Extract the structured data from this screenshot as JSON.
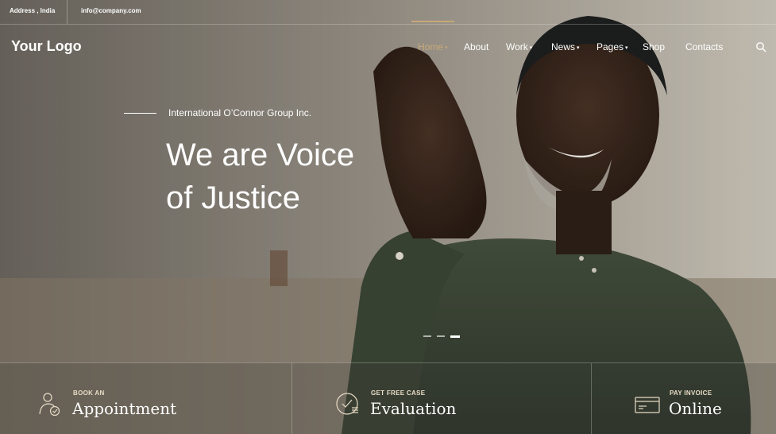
{
  "topbar": {
    "address": "Address , India",
    "email": "info@company.com"
  },
  "header": {
    "logo": "Your Logo"
  },
  "nav": {
    "items": [
      {
        "label": "Home",
        "active": true,
        "has_dropdown": true
      },
      {
        "label": "About",
        "active": false,
        "has_dropdown": false
      },
      {
        "label": "Work",
        "active": false,
        "has_dropdown": true
      },
      {
        "label": "News",
        "active": false,
        "has_dropdown": true
      },
      {
        "label": "Pages",
        "active": false,
        "has_dropdown": true
      },
      {
        "label": "Shop",
        "active": false,
        "has_dropdown": false
      },
      {
        "label": "Contacts",
        "active": false,
        "has_dropdown": false
      }
    ],
    "search_icon": "search-icon"
  },
  "hero": {
    "eyebrow": "International O’Connor Group Inc.",
    "headline_line1": "We are Voice",
    "headline_line2": "of Justice"
  },
  "slider": {
    "slides": 3,
    "active_index": 2
  },
  "cta": [
    {
      "small": "BOOK AN",
      "big": "Appointment",
      "icon": "user-check-icon"
    },
    {
      "small": "GET FREE CASE",
      "big": "Evaluation",
      "icon": "checklist-icon"
    },
    {
      "small": "PAY INVOICE",
      "big": "Online",
      "icon": "credit-card-icon"
    }
  ],
  "colors": {
    "accent": "#c8a978",
    "text": "#ffffff"
  }
}
